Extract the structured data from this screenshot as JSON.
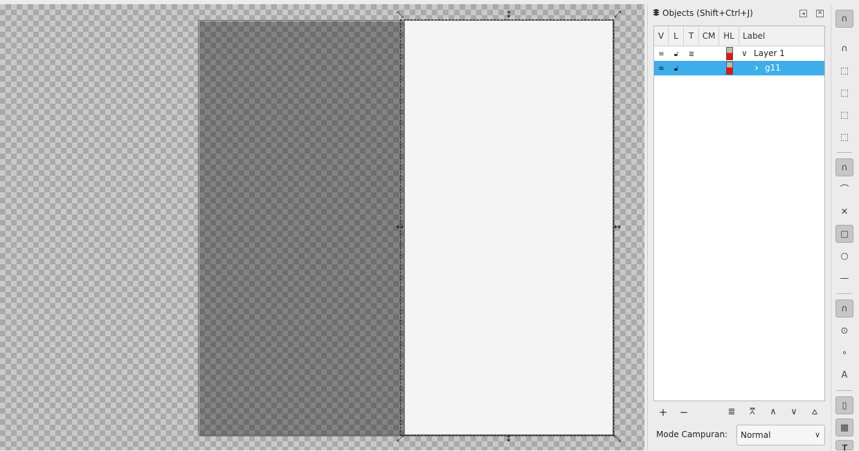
{
  "panel": {
    "title": "Objects (Shift+Ctrl+J)",
    "columns": [
      "V",
      "L",
      "T",
      "CM",
      "HL",
      "Label"
    ],
    "rows": [
      {
        "label": "Layer 1",
        "expander": "∨",
        "selected": false,
        "has_type_icon": true
      },
      {
        "label": "g11",
        "expander": "›",
        "selected": true,
        "has_type_icon": false
      }
    ],
    "highlight_color": "#e8140c",
    "selection_color": "#3daee9",
    "toolbar_icons": [
      "add-icon",
      "remove-icon",
      "indent-icon",
      "move-to-top-icon",
      "move-up-icon",
      "move-down-icon",
      "move-to-bottom-icon"
    ],
    "blend_label": "Mode Campuran:",
    "blend_value": "Normal"
  },
  "snapbar": {
    "icons": [
      "snap-toggle-icon",
      "snap-bbox-icon",
      "snap-bbox-edge-icon",
      "snap-bbox-corner-icon",
      "snap-bbox-midpoint-icon",
      "snap-bbox-center-icon",
      "snap-nodes-icon",
      "snap-path-icon",
      "snap-intersection-icon",
      "snap-cusp-node-icon",
      "snap-smooth-node-icon",
      "snap-line-midpoint-icon",
      "snap-others-icon",
      "snap-object-center-icon",
      "snap-rotation-center-icon",
      "snap-text-baseline-icon",
      "snap-page-border-icon",
      "snap-grid-icon",
      "snap-guide-icon"
    ]
  }
}
